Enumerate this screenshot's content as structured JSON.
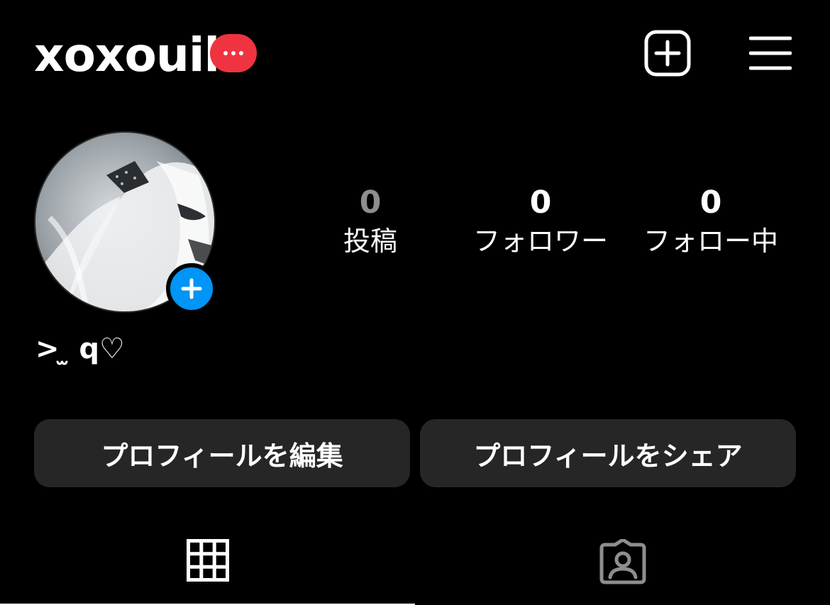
{
  "header": {
    "username": "xoxouil",
    "notification_dots": "···"
  },
  "profile": {
    "stats": [
      {
        "count": "0",
        "label": "投稿"
      },
      {
        "count": "0",
        "label": "フォロワー"
      },
      {
        "count": "0",
        "label": "フォロー中"
      }
    ],
    "bio": "> ̫ q♡"
  },
  "actions": {
    "edit_label": "プロフィールを編集",
    "share_label": "プロフィールをシェア"
  },
  "tabs": [
    {
      "icon": "grid-icon",
      "active": true
    },
    {
      "icon": "tagged-person-icon",
      "active": false
    }
  ],
  "colors": {
    "background": "#000000",
    "badge": "#ef3340",
    "add_story": "#0095f6",
    "button_bg": "#262626",
    "muted": "#8e8e8e"
  }
}
